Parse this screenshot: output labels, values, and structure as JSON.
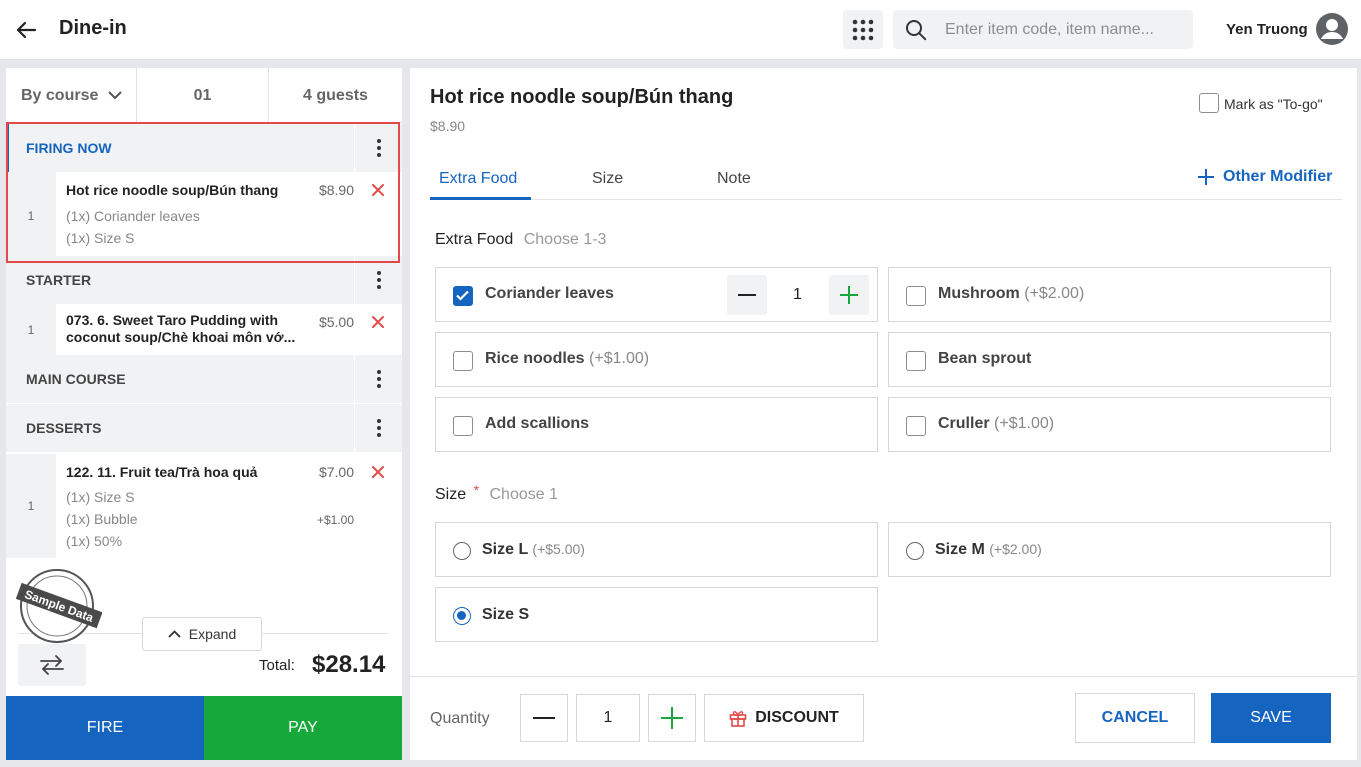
{
  "header": {
    "title": "Dine-in",
    "search_placeholder": "Enter item code, item name...",
    "user_name": "Yen Truong"
  },
  "order": {
    "view_mode": "By course",
    "table": "01",
    "guests": "4 guests",
    "groups": [
      {
        "label": "FIRING NOW",
        "items": [
          {
            "qty": "1",
            "name": "Hot rice noodle soup/Bún thang",
            "price": "$8.90",
            "modifiers": [
              {
                "text": "(1x) Coriander leaves",
                "price": ""
              },
              {
                "text": "(1x) Size S",
                "price": ""
              }
            ]
          }
        ]
      },
      {
        "label": "STARTER",
        "items": [
          {
            "qty": "1",
            "name": "073. 6. Sweet Taro Pudding with coconut soup/Chè khoai môn vớ...",
            "price": "$5.00",
            "modifiers": []
          }
        ]
      },
      {
        "label": "MAIN COURSE",
        "items": []
      },
      {
        "label": "DESSERTS",
        "items": [
          {
            "qty": "1",
            "name": "122. 11. Fruit tea/Trà hoa quả",
            "price": "$7.00",
            "modifiers": [
              {
                "text": "(1x) Size S",
                "price": ""
              },
              {
                "text": "(1x) Bubble",
                "price": "+$1.00"
              },
              {
                "text": "(1x) 50%",
                "price": ""
              }
            ]
          }
        ]
      }
    ],
    "watermark": "Sample Data",
    "expand_label": "Expand",
    "total_label": "Total:",
    "total_value": "$28.14",
    "fire_label": "FIRE",
    "pay_label": "PAY"
  },
  "detail": {
    "item_name": "Hot rice noodle soup/Bún thang",
    "item_price": "$8.90",
    "togo_label": "Mark as \"To-go\"",
    "tabs": [
      "Extra Food",
      "Size",
      "Note"
    ],
    "other_modifier": "Other Modifier",
    "extra_food": {
      "title": "Extra Food",
      "hint": "Choose 1-3",
      "options": [
        {
          "name": "Coriander leaves",
          "price": "",
          "checked": true,
          "qty": "1"
        },
        {
          "name": "Mushroom",
          "price": "(+$2.00)",
          "checked": false
        },
        {
          "name": "Rice noodles",
          "price": "(+$1.00)",
          "checked": false
        },
        {
          "name": "Bean sprout",
          "price": "",
          "checked": false
        },
        {
          "name": "Add scallions",
          "price": "",
          "checked": false
        },
        {
          "name": "Cruller",
          "price": "(+$1.00)",
          "checked": false
        }
      ]
    },
    "size": {
      "title": "Size",
      "required_mark": "*",
      "hint": "Choose 1",
      "options": [
        {
          "name": "Size L",
          "price": "(+$5.00)",
          "selected": false
        },
        {
          "name": "Size M",
          "price": "(+$2.00)",
          "selected": false
        },
        {
          "name": "Size S",
          "price": "",
          "selected": true
        }
      ]
    },
    "footer": {
      "quantity_label": "Quantity",
      "quantity_value": "1",
      "discount_label": "DISCOUNT",
      "cancel_label": "CANCEL",
      "save_label": "SAVE"
    }
  },
  "colors": {
    "primary": "#1565c0",
    "pay_green": "#16a83a",
    "highlight_red": "#e24a4a",
    "delete_red": "#e24a4a"
  }
}
